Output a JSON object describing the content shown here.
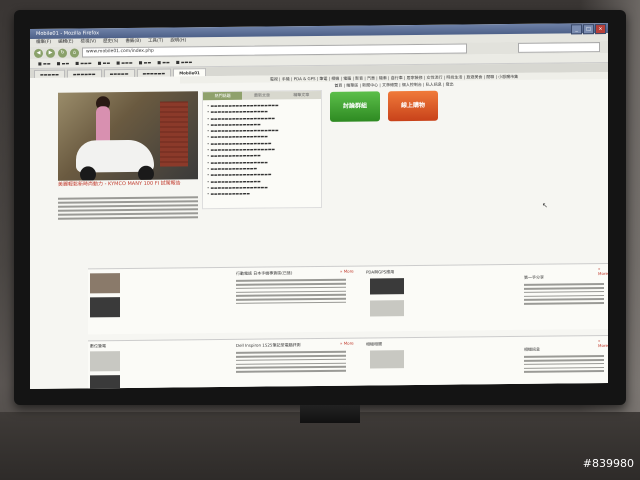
{
  "window": {
    "title": "Mobile01 - Mozilla Firefox",
    "controls": [
      "_",
      "□",
      "×"
    ]
  },
  "menubar": [
    "檔案(F)",
    "編輯(E)",
    "檢視(V)",
    "歷史(S)",
    "書籤(B)",
    "工具(T)",
    "說明(H)"
  ],
  "navbar": {
    "url": "www.mobile01.com/index.php"
  },
  "tabs": [
    {
      "label": "Mobile01"
    }
  ],
  "page": {
    "site_nav_1": "電視 | 手機 | PDA & GPS | 筆電 | 相機 | 電腦 | 影音 | 汽車 | 機車 | 自行車 | 居家裝修 | 女性流行 | 時尚生活 | 旅遊美食 | 閒聊 | 小惡魔市集",
    "site_nav_2": "首頁 | 精華區 | 新聞中心 | 文章總覽 | 個人控制台 | 私人訊息 | 登出",
    "hero_caption": "美麗輕鬆新時尚動力 - KYMCO MANY 100 FI 試駕報告",
    "mid_tabs": [
      "熱門話題",
      "最新文章",
      "精華文章"
    ],
    "green_button": "討論群組",
    "orange_button": "線上購物",
    "section1_titles": [
      "行動電話 日本手機專賣區(已售)",
      "PDA與GPS應用",
      "第一手分享"
    ],
    "section2_titles": [
      "數位筆電",
      "Dell Inspiron 1525筆記型電腦評測",
      "相機相關",
      "相機訊息"
    ],
    "more_label": "» More",
    "watermark": "#839980"
  }
}
